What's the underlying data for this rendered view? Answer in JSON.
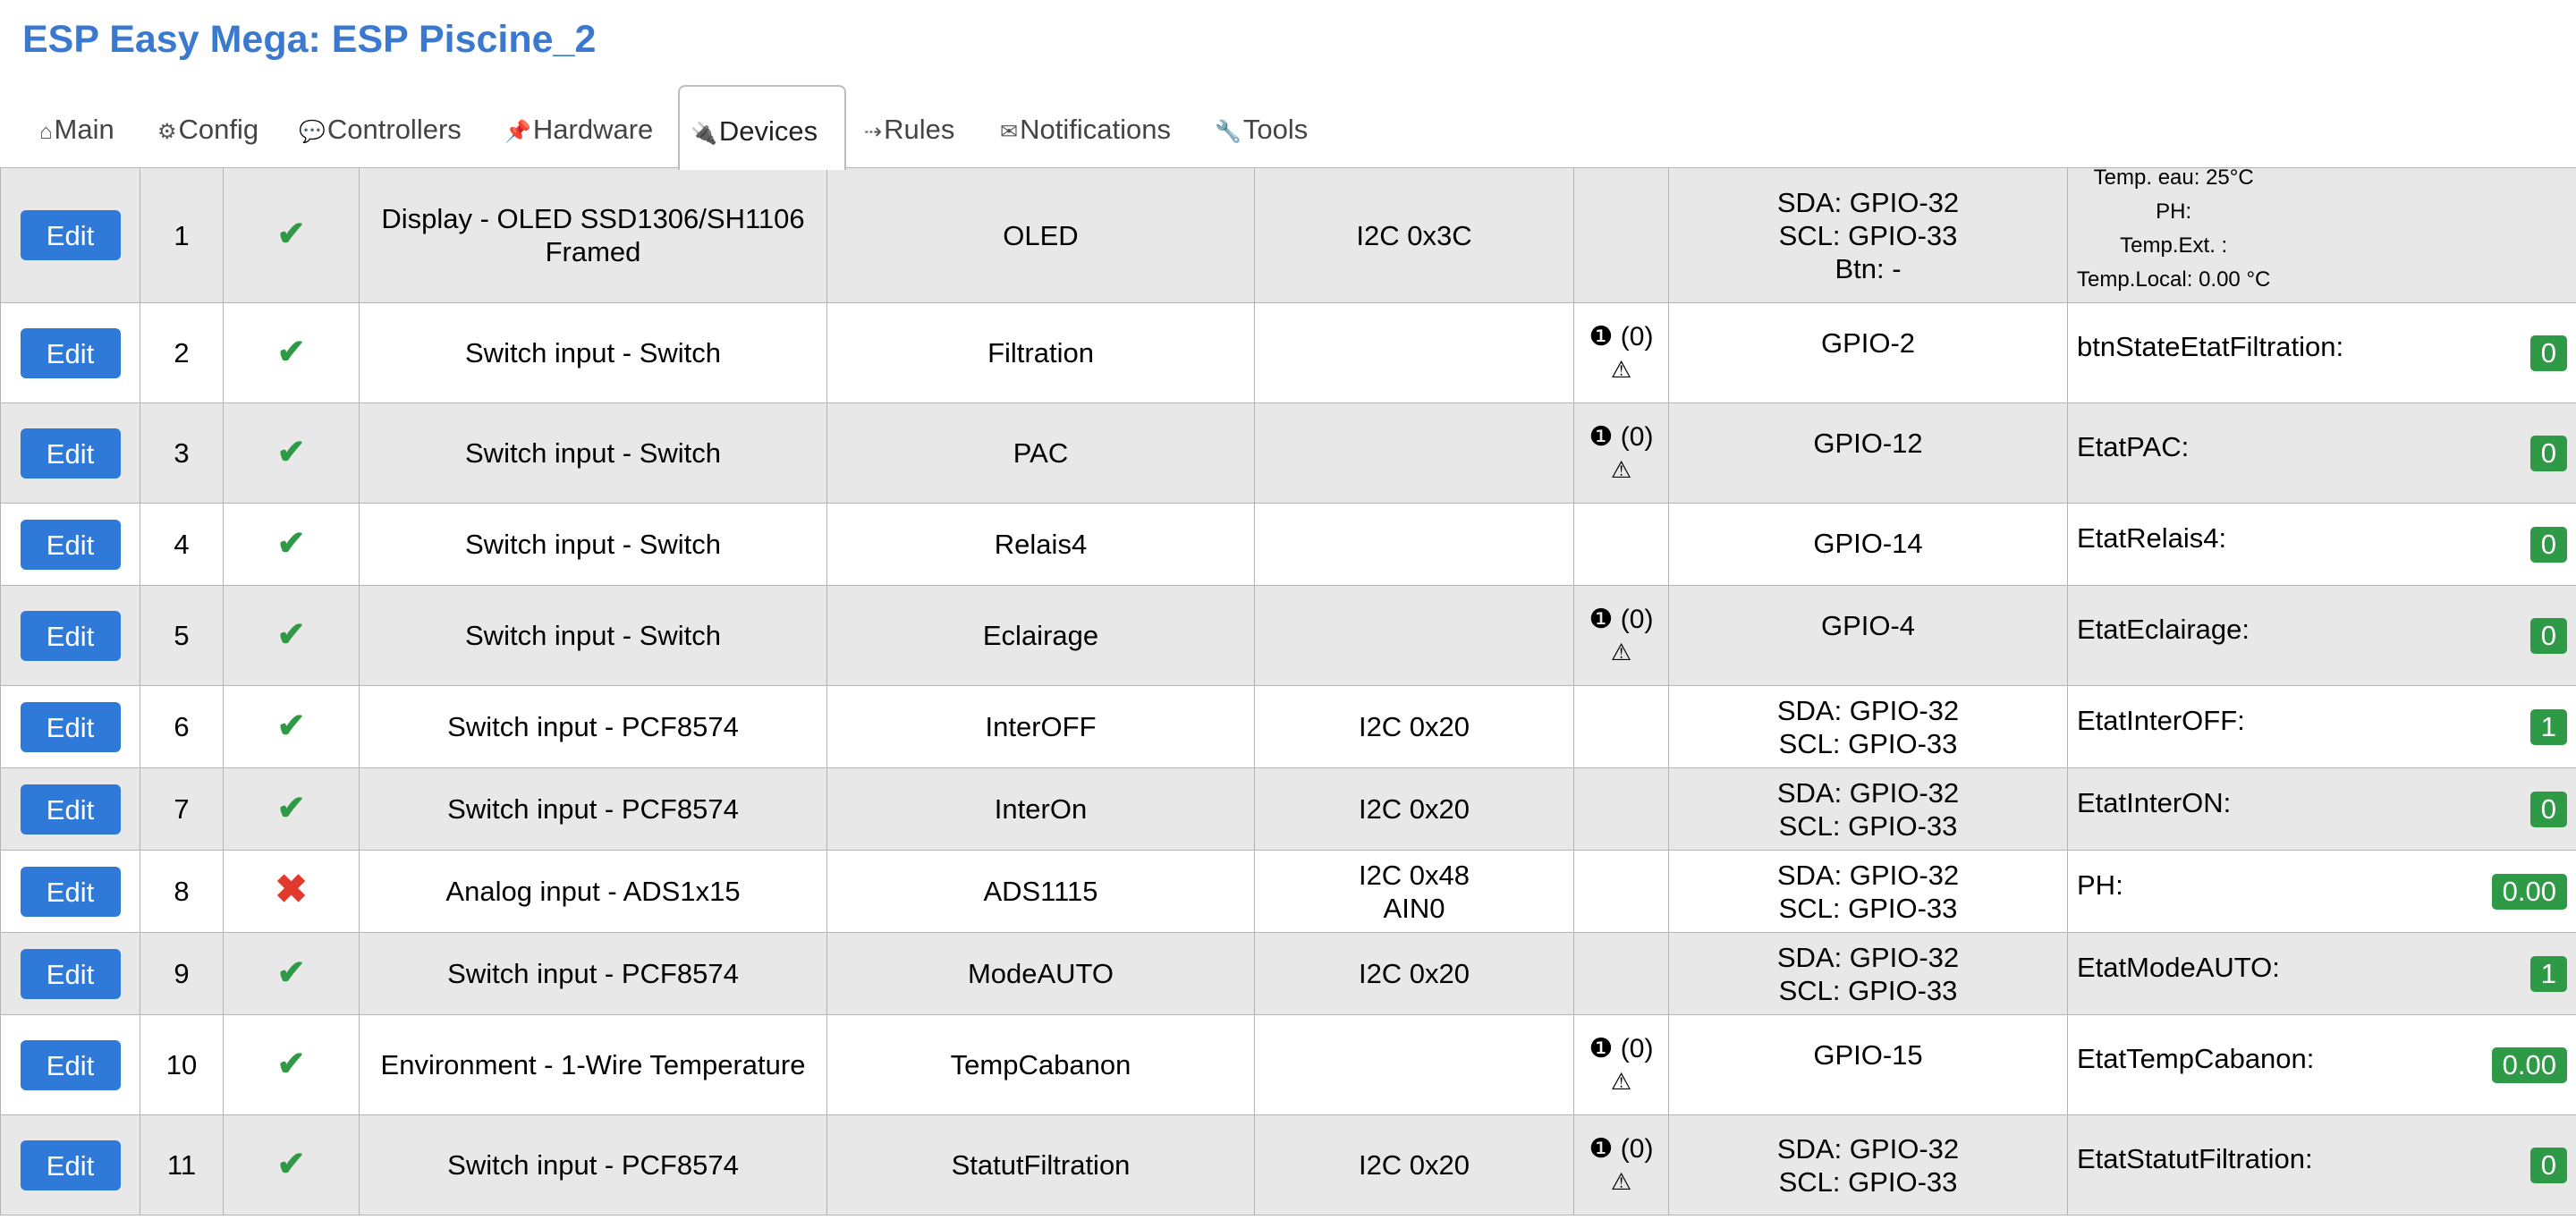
{
  "title": "ESP Easy Mega: ESP Piscine_2",
  "tabs": [
    {
      "icon": "⌂",
      "label": "Main"
    },
    {
      "icon": "⚙",
      "label": "Config"
    },
    {
      "icon": "💬",
      "label": "Controllers"
    },
    {
      "icon": "📌",
      "label": "Hardware"
    },
    {
      "icon": "🔌",
      "label": "Devices"
    },
    {
      "icon": "⇢",
      "label": "Rules"
    },
    {
      "icon": "✉",
      "label": "Notifications"
    },
    {
      "icon": "🔧",
      "label": "Tools"
    }
  ],
  "active_tab": "Devices",
  "edit_label": "Edit",
  "stat_count": "(0)",
  "devices": [
    {
      "index": "1",
      "enabled": true,
      "device": "Display - OLED SSD1306/SH1106 Framed",
      "name": "OLED",
      "port": "I2C 0x3C",
      "stats": false,
      "gpio": [
        "SDA: GPIO-32",
        "SCL: GPIO-33",
        "Btn: -"
      ],
      "values": [
        "Temp. eau: 25°C",
        "PH:",
        "Temp.Ext. :",
        "Temp.Local: 0.00 °C"
      ]
    },
    {
      "index": "2",
      "enabled": true,
      "device": "Switch input - Switch",
      "name": "Filtration",
      "port": "",
      "stats": true,
      "gpio": [
        "GPIO-2"
      ],
      "value_name": "btnStateEtatFiltration:",
      "value": "0"
    },
    {
      "index": "3",
      "enabled": true,
      "device": "Switch input - Switch",
      "name": "PAC",
      "port": "",
      "stats": true,
      "gpio": [
        "GPIO-12"
      ],
      "value_name": "EtatPAC:",
      "value": "0"
    },
    {
      "index": "4",
      "enabled": true,
      "device": "Switch input - Switch",
      "name": "Relais4",
      "port": "",
      "stats": false,
      "gpio": [
        "GPIO-14"
      ],
      "value_name": "EtatRelais4:",
      "value": "0"
    },
    {
      "index": "5",
      "enabled": true,
      "device": "Switch input - Switch",
      "name": "Eclairage",
      "port": "",
      "stats": true,
      "gpio": [
        "GPIO-4"
      ],
      "value_name": "EtatEclairage:",
      "value": "0"
    },
    {
      "index": "6",
      "enabled": true,
      "device": "Switch input - PCF8574",
      "name": "InterOFF",
      "port": "I2C 0x20",
      "stats": false,
      "gpio": [
        "SDA: GPIO-32",
        "SCL: GPIO-33"
      ],
      "value_name": "EtatInterOFF:",
      "value": "1"
    },
    {
      "index": "7",
      "enabled": true,
      "device": "Switch input - PCF8574",
      "name": "InterOn",
      "port": "I2C 0x20",
      "stats": false,
      "gpio": [
        "SDA: GPIO-32",
        "SCL: GPIO-33"
      ],
      "value_name": "EtatInterON:",
      "value": "0"
    },
    {
      "index": "8",
      "enabled": false,
      "device": "Analog input - ADS1x15",
      "name": "ADS1115",
      "port": "I2C 0x48",
      "port2": "AIN0",
      "stats": false,
      "gpio": [
        "SDA: GPIO-32",
        "SCL: GPIO-33"
      ],
      "value_name": "PH:",
      "value": "0.00"
    },
    {
      "index": "9",
      "enabled": true,
      "device": "Switch input - PCF8574",
      "name": "ModeAUTO",
      "port": "I2C 0x20",
      "stats": false,
      "gpio": [
        "SDA: GPIO-32",
        "SCL: GPIO-33"
      ],
      "value_name": "EtatModeAUTO:",
      "value": "1"
    },
    {
      "index": "10",
      "enabled": true,
      "device": "Environment - 1-Wire Temperature",
      "name": "TempCabanon",
      "port": "",
      "stats": true,
      "gpio": [
        "GPIO-15"
      ],
      "value_name": "EtatTempCabanon:",
      "value": "0.00"
    },
    {
      "index": "11",
      "enabled": true,
      "device": "Switch input - PCF8574",
      "name": "StatutFiltration",
      "port": "I2C 0x20",
      "stats": true,
      "gpio": [
        "SDA: GPIO-32",
        "SCL: GPIO-33"
      ],
      "value_name": "EtatStatutFiltration:",
      "value": "0"
    }
  ]
}
